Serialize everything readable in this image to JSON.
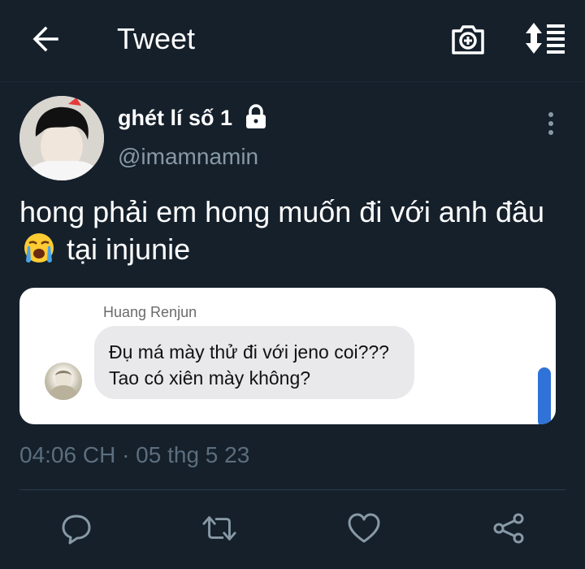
{
  "header": {
    "title": "Tweet",
    "back_icon": "arrow-left-icon",
    "camera_icon": "camera-plus-icon",
    "sort_icon": "sort-list-icon"
  },
  "tweet": {
    "display_name": "ghét lí số 1",
    "handle": "@imamnamin",
    "text_before_emoji": "hong phải em hong muốn đi với anh đâu",
    "emoji": "loudly-crying-face",
    "text_after_emoji": "tại injunie",
    "timestamp": "04:06 CH · 05 thg 5 23",
    "locked": true
  },
  "media": {
    "sender_name": "Huang Renjun",
    "message": "Đụ má mày thử đi với jeno coi??? Tao có xiên mày không?"
  },
  "actions": [
    "reply-icon",
    "retweet-icon",
    "like-icon",
    "share-icon"
  ],
  "colors": {
    "background": "#15202b",
    "muted": "#8899a6",
    "accent": "#2f73d8"
  }
}
